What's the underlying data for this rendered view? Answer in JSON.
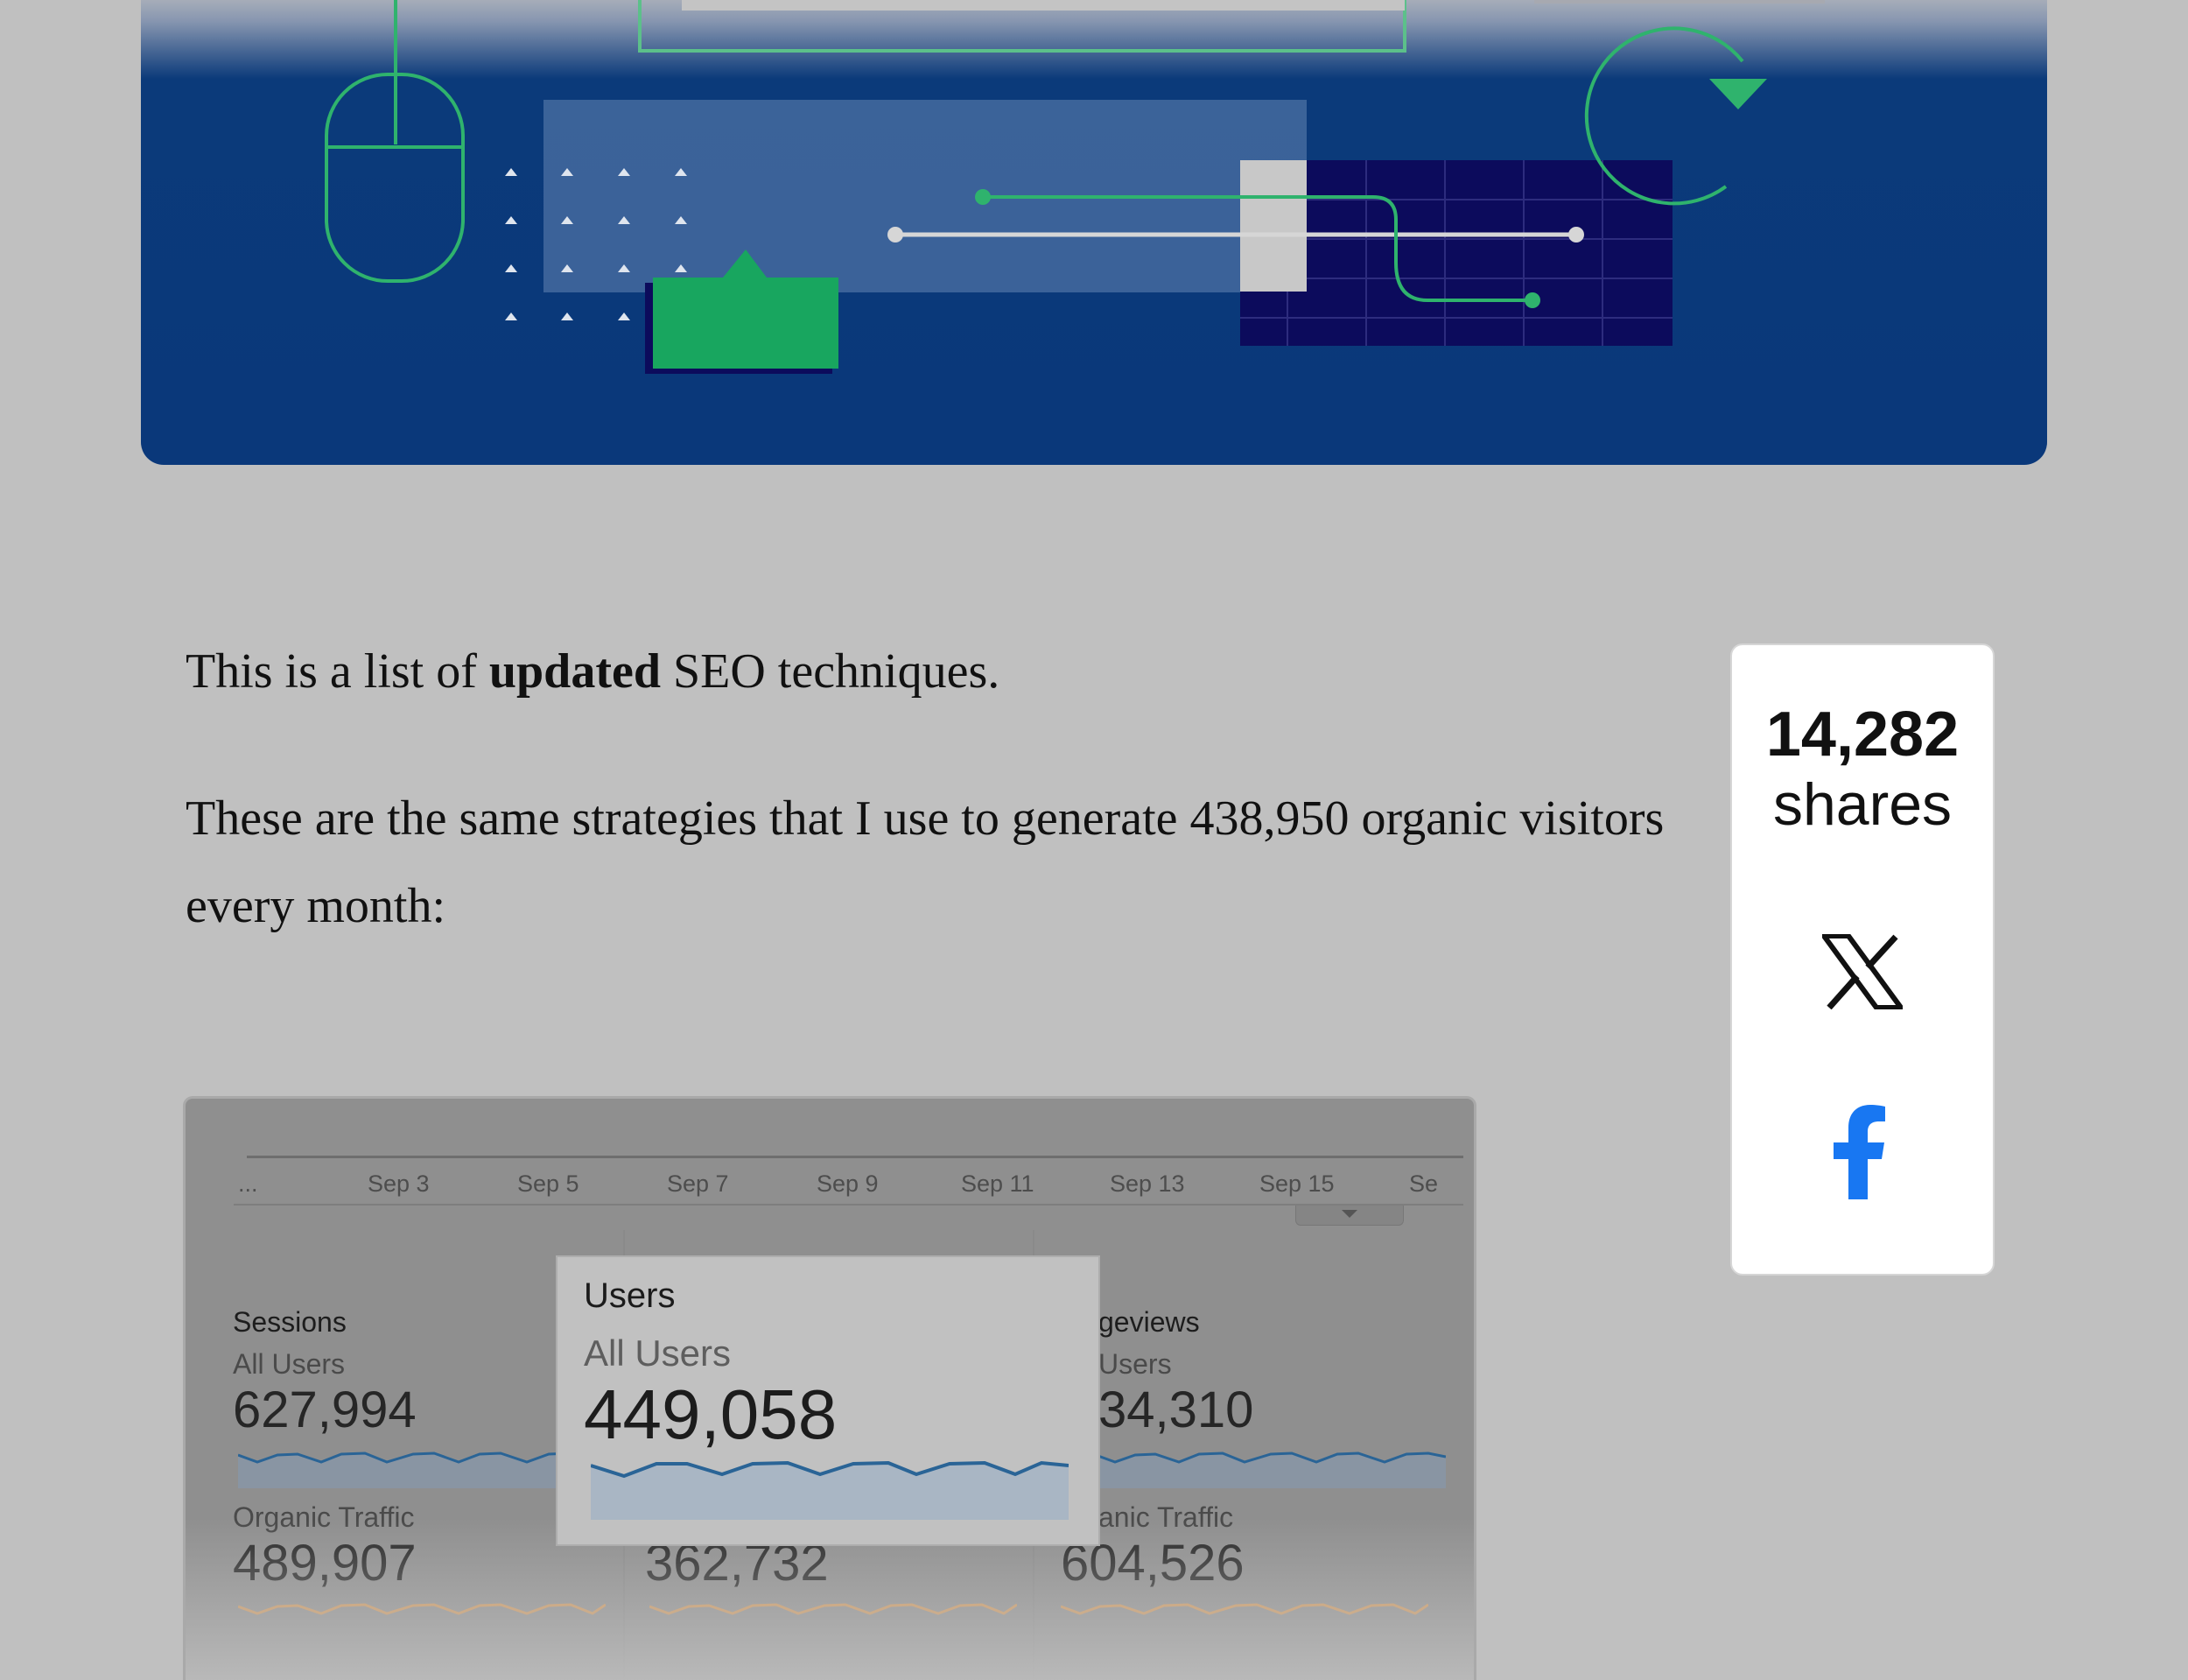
{
  "hero": {
    "image": "technical-seo-illustration"
  },
  "article": {
    "p1_before": "This is a list of ",
    "p1_bold": "updated",
    "p1_after": " SEO techniques.",
    "p2": "These are the same strategies that I use to generate 438,950 organic visitors every month:"
  },
  "share": {
    "count": "14,282",
    "label": "shares",
    "x_icon": "x-icon",
    "facebook_icon": "facebook-icon",
    "facebook_color": "#1877f2"
  },
  "dashboard": {
    "ticks": [
      "...",
      "Sep 3",
      "Sep 5",
      "Sep 7",
      "Sep 9",
      "Sep 11",
      "Sep 13",
      "Sep 15",
      "Se"
    ],
    "col1": {
      "title": "Sessions",
      "segment": "All Users",
      "value": "627,994",
      "organic_label": "Organic Traffic",
      "organic_value": "489,907"
    },
    "col2": {
      "organic_value": "362,732"
    },
    "col3": {
      "title": "geviews",
      "segment": "Users",
      "value": "34,310",
      "organic_label": "anic Traffic",
      "organic_value": "604,526"
    },
    "tooltip": {
      "title": "Users",
      "segment": "All Users",
      "value": "449,058"
    },
    "colors": {
      "line_blue": "#2a6496",
      "line_orange": "#d69a5a",
      "fill_blue": "#a9b6c4"
    }
  }
}
